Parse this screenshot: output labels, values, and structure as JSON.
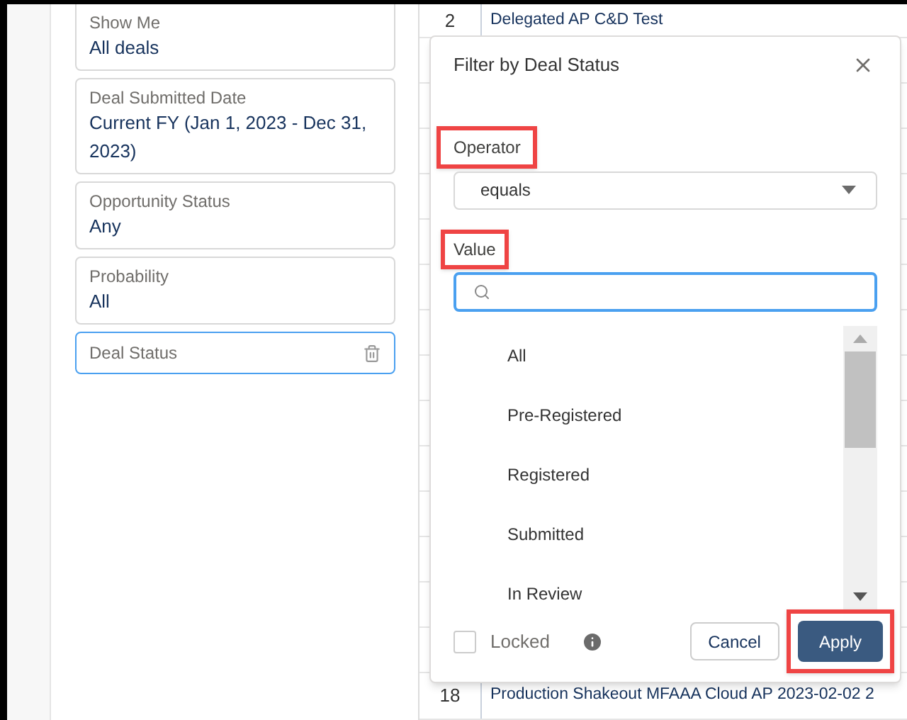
{
  "filters": [
    {
      "label": "Show Me",
      "value": "All deals",
      "selected": false
    },
    {
      "label": "Deal Submitted Date",
      "value": "Current FY (Jan 1, 2023 - Dec 31, 2023)",
      "selected": false
    },
    {
      "label": "Opportunity Status",
      "value": "Any",
      "selected": false
    },
    {
      "label": "Probability",
      "value": "All",
      "selected": false
    },
    {
      "label": "Deal Status",
      "selected": true
    }
  ],
  "table": {
    "rows": [
      {
        "number": "2",
        "name": "Delegated AP C&D Test"
      },
      {
        "number": "18",
        "name": "Production Shakeout MFAAA Cloud AP 2023-02-02 2"
      }
    ]
  },
  "popover": {
    "title": "Filter by Deal Status",
    "operator": {
      "label": "Operator",
      "value": "equals"
    },
    "value": {
      "label": "Value"
    },
    "options": [
      "All",
      "Pre-Registered",
      "Registered",
      "Submitted",
      "In Review"
    ],
    "locked": {
      "label": "Locked",
      "checked": false
    },
    "buttons": {
      "cancel": "Cancel",
      "apply": "Apply"
    }
  }
}
